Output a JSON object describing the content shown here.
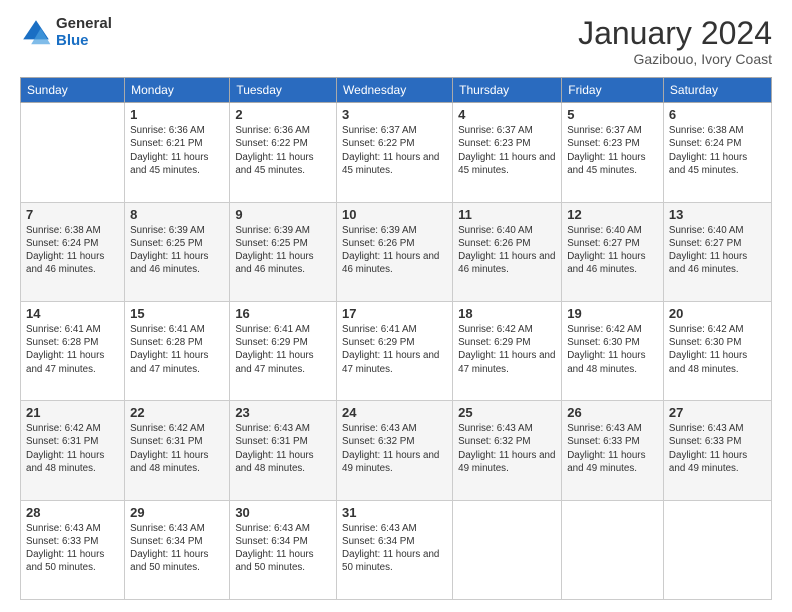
{
  "logo": {
    "general": "General",
    "blue": "Blue"
  },
  "header": {
    "title": "January 2024",
    "subtitle": "Gazibouo, Ivory Coast"
  },
  "calendar": {
    "days": [
      "Sunday",
      "Monday",
      "Tuesday",
      "Wednesday",
      "Thursday",
      "Friday",
      "Saturday"
    ],
    "weeks": [
      [
        {
          "day": "",
          "sunrise": "",
          "sunset": "",
          "daylight": ""
        },
        {
          "day": "1",
          "sunrise": "Sunrise: 6:36 AM",
          "sunset": "Sunset: 6:21 PM",
          "daylight": "Daylight: 11 hours and 45 minutes."
        },
        {
          "day": "2",
          "sunrise": "Sunrise: 6:36 AM",
          "sunset": "Sunset: 6:22 PM",
          "daylight": "Daylight: 11 hours and 45 minutes."
        },
        {
          "day": "3",
          "sunrise": "Sunrise: 6:37 AM",
          "sunset": "Sunset: 6:22 PM",
          "daylight": "Daylight: 11 hours and 45 minutes."
        },
        {
          "day": "4",
          "sunrise": "Sunrise: 6:37 AM",
          "sunset": "Sunset: 6:23 PM",
          "daylight": "Daylight: 11 hours and 45 minutes."
        },
        {
          "day": "5",
          "sunrise": "Sunrise: 6:37 AM",
          "sunset": "Sunset: 6:23 PM",
          "daylight": "Daylight: 11 hours and 45 minutes."
        },
        {
          "day": "6",
          "sunrise": "Sunrise: 6:38 AM",
          "sunset": "Sunset: 6:24 PM",
          "daylight": "Daylight: 11 hours and 45 minutes."
        }
      ],
      [
        {
          "day": "7",
          "sunrise": "Sunrise: 6:38 AM",
          "sunset": "Sunset: 6:24 PM",
          "daylight": "Daylight: 11 hours and 46 minutes."
        },
        {
          "day": "8",
          "sunrise": "Sunrise: 6:39 AM",
          "sunset": "Sunset: 6:25 PM",
          "daylight": "Daylight: 11 hours and 46 minutes."
        },
        {
          "day": "9",
          "sunrise": "Sunrise: 6:39 AM",
          "sunset": "Sunset: 6:25 PM",
          "daylight": "Daylight: 11 hours and 46 minutes."
        },
        {
          "day": "10",
          "sunrise": "Sunrise: 6:39 AM",
          "sunset": "Sunset: 6:26 PM",
          "daylight": "Daylight: 11 hours and 46 minutes."
        },
        {
          "day": "11",
          "sunrise": "Sunrise: 6:40 AM",
          "sunset": "Sunset: 6:26 PM",
          "daylight": "Daylight: 11 hours and 46 minutes."
        },
        {
          "day": "12",
          "sunrise": "Sunrise: 6:40 AM",
          "sunset": "Sunset: 6:27 PM",
          "daylight": "Daylight: 11 hours and 46 minutes."
        },
        {
          "day": "13",
          "sunrise": "Sunrise: 6:40 AM",
          "sunset": "Sunset: 6:27 PM",
          "daylight": "Daylight: 11 hours and 46 minutes."
        }
      ],
      [
        {
          "day": "14",
          "sunrise": "Sunrise: 6:41 AM",
          "sunset": "Sunset: 6:28 PM",
          "daylight": "Daylight: 11 hours and 47 minutes."
        },
        {
          "day": "15",
          "sunrise": "Sunrise: 6:41 AM",
          "sunset": "Sunset: 6:28 PM",
          "daylight": "Daylight: 11 hours and 47 minutes."
        },
        {
          "day": "16",
          "sunrise": "Sunrise: 6:41 AM",
          "sunset": "Sunset: 6:29 PM",
          "daylight": "Daylight: 11 hours and 47 minutes."
        },
        {
          "day": "17",
          "sunrise": "Sunrise: 6:41 AM",
          "sunset": "Sunset: 6:29 PM",
          "daylight": "Daylight: 11 hours and 47 minutes."
        },
        {
          "day": "18",
          "sunrise": "Sunrise: 6:42 AM",
          "sunset": "Sunset: 6:29 PM",
          "daylight": "Daylight: 11 hours and 47 minutes."
        },
        {
          "day": "19",
          "sunrise": "Sunrise: 6:42 AM",
          "sunset": "Sunset: 6:30 PM",
          "daylight": "Daylight: 11 hours and 48 minutes."
        },
        {
          "day": "20",
          "sunrise": "Sunrise: 6:42 AM",
          "sunset": "Sunset: 6:30 PM",
          "daylight": "Daylight: 11 hours and 48 minutes."
        }
      ],
      [
        {
          "day": "21",
          "sunrise": "Sunrise: 6:42 AM",
          "sunset": "Sunset: 6:31 PM",
          "daylight": "Daylight: 11 hours and 48 minutes."
        },
        {
          "day": "22",
          "sunrise": "Sunrise: 6:42 AM",
          "sunset": "Sunset: 6:31 PM",
          "daylight": "Daylight: 11 hours and 48 minutes."
        },
        {
          "day": "23",
          "sunrise": "Sunrise: 6:43 AM",
          "sunset": "Sunset: 6:31 PM",
          "daylight": "Daylight: 11 hours and 48 minutes."
        },
        {
          "day": "24",
          "sunrise": "Sunrise: 6:43 AM",
          "sunset": "Sunset: 6:32 PM",
          "daylight": "Daylight: 11 hours and 49 minutes."
        },
        {
          "day": "25",
          "sunrise": "Sunrise: 6:43 AM",
          "sunset": "Sunset: 6:32 PM",
          "daylight": "Daylight: 11 hours and 49 minutes."
        },
        {
          "day": "26",
          "sunrise": "Sunrise: 6:43 AM",
          "sunset": "Sunset: 6:33 PM",
          "daylight": "Daylight: 11 hours and 49 minutes."
        },
        {
          "day": "27",
          "sunrise": "Sunrise: 6:43 AM",
          "sunset": "Sunset: 6:33 PM",
          "daylight": "Daylight: 11 hours and 49 minutes."
        }
      ],
      [
        {
          "day": "28",
          "sunrise": "Sunrise: 6:43 AM",
          "sunset": "Sunset: 6:33 PM",
          "daylight": "Daylight: 11 hours and 50 minutes."
        },
        {
          "day": "29",
          "sunrise": "Sunrise: 6:43 AM",
          "sunset": "Sunset: 6:34 PM",
          "daylight": "Daylight: 11 hours and 50 minutes."
        },
        {
          "day": "30",
          "sunrise": "Sunrise: 6:43 AM",
          "sunset": "Sunset: 6:34 PM",
          "daylight": "Daylight: 11 hours and 50 minutes."
        },
        {
          "day": "31",
          "sunrise": "Sunrise: 6:43 AM",
          "sunset": "Sunset: 6:34 PM",
          "daylight": "Daylight: 11 hours and 50 minutes."
        },
        {
          "day": "",
          "sunrise": "",
          "sunset": "",
          "daylight": ""
        },
        {
          "day": "",
          "sunrise": "",
          "sunset": "",
          "daylight": ""
        },
        {
          "day": "",
          "sunrise": "",
          "sunset": "",
          "daylight": ""
        }
      ]
    ]
  }
}
